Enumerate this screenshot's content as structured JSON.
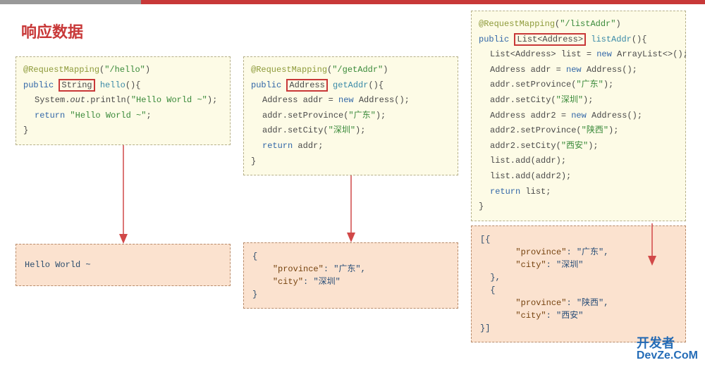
{
  "title": "响应数据",
  "colors": {
    "accent": "#c83838",
    "codeBg": "#fdfbe6",
    "outBg": "#fbe2cf"
  },
  "col1": {
    "code": {
      "l1a": "@RequestMapping",
      "l1b": "(",
      "l1c": "\"/hello\"",
      "l1d": ")",
      "l2a": "public",
      "l2b": "String",
      "l2c": "hello",
      "l2d": "(){",
      "l3a": "System.",
      "l3b": "out",
      "l3c": ".println(",
      "l3d": "\"Hello World ~\"",
      "l3e": ");",
      "l4a": "return",
      "l4b": "\"Hello World ~\"",
      "l4c": ";",
      "l5": "}"
    },
    "output": "Hello World ~"
  },
  "col2": {
    "code": {
      "l1a": "@RequestMapping",
      "l1b": "(",
      "l1c": "\"/getAddr\"",
      "l1d": ")",
      "l2a": "public",
      "l2b": "Address",
      "l2c": "getAddr",
      "l2d": "(){",
      "l3a": "Address addr = ",
      "l3b": "new",
      "l3c": " Address();",
      "l4a": "addr.setProvince(",
      "l4b": "\"广东\"",
      "l4c": ");",
      "l5a": "addr.setCity(",
      "l5b": "\"深圳\"",
      "l5c": ");",
      "l6a": "return",
      "l6b": " addr;",
      "l7": "}"
    },
    "output": {
      "open": "{",
      "k1": "\"province\"",
      "v1": "\"广东\"",
      "k2": "\"city\"",
      "v2": "\"深圳\"",
      "close": "}"
    }
  },
  "col3": {
    "code": {
      "l1a": "@RequestMapping",
      "l1b": "(",
      "l1c": "\"/listAddr\"",
      "l1d": ")",
      "l2a": "public",
      "l2b": "List<Address>",
      "l2c": "listAddr",
      "l2d": "(){",
      "l3a": "List<Address> list = ",
      "l3b": "new",
      "l3c": " ArrayList<>();",
      "l4a": "Address addr = ",
      "l4b": "new",
      "l4c": " Address();",
      "l5a": "addr.setProvince(",
      "l5b": "\"广东\"",
      "l5c": ");",
      "l6a": "addr.setCity(",
      "l6b": "\"深圳\"",
      "l6c": ");",
      "l7a": "Address addr2 = ",
      "l7b": "new",
      "l7c": " Address();",
      "l8a": "addr2.setProvince(",
      "l8b": "\"陕西\"",
      "l8c": ");",
      "l9a": "addr2.setCity(",
      "l9b": "\"西安\"",
      "l9c": ");",
      "l10": "list.add(addr);",
      "l11": "list.add(addr2);",
      "l12a": "return",
      "l12b": " list;",
      "l13": "}"
    },
    "output": {
      "open": "[{",
      "k1": "\"province\"",
      "v1": "\"广东\"",
      "k2": "\"city\"",
      "v2": "\"深圳\"",
      "mid1": "},",
      "mid2": "{",
      "k3": "\"province\"",
      "v3": "\"陕西\"",
      "k4": "\"city\"",
      "v4": "\"西安\"",
      "close": "}]"
    }
  },
  "watermark": {
    "line1": "开发者",
    "line2": "DevZe.CoM"
  }
}
